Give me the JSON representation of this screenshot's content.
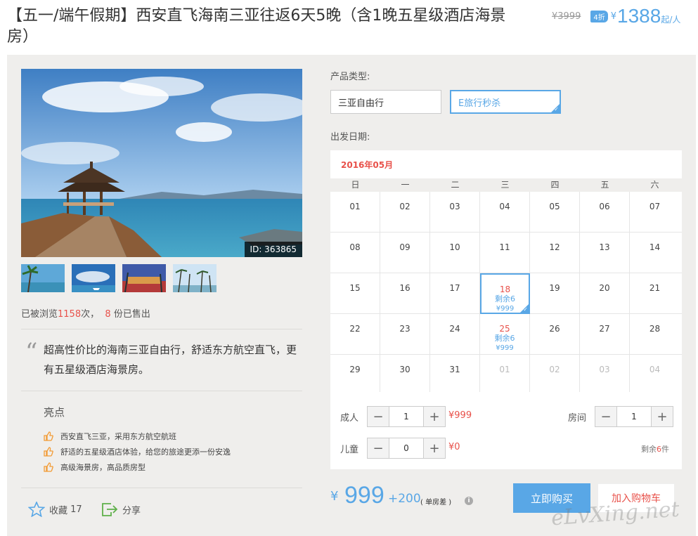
{
  "header": {
    "title": "【五一/端午假期】西安直飞海南三亚往返6天5晚（含1晚五星级酒店海景房）",
    "old_price": "¥3999",
    "discount": "4折",
    "currency": "¥",
    "price": "1388",
    "price_unit": "起/人"
  },
  "gallery": {
    "image_id": "ID: 363865",
    "thumbnails": [
      "beach-palms",
      "sky-boat",
      "resort-hotel",
      "palm-coast"
    ]
  },
  "stats": {
    "prefix": "已被浏览",
    "views": "1158",
    "mid": "次，",
    "sold": "8",
    "suffix": "份已售出"
  },
  "description": "超高性价比的海南三亚自由行，舒适东方航空直飞，更有五星级酒店海景房。",
  "highlights": {
    "title": "亮点",
    "items": [
      "西安直飞三亚，采用东方航空航班",
      "舒适的五星级酒店体验，给您的旅途更添一份安逸",
      "高级海景房，高品质房型"
    ]
  },
  "social": {
    "fav_label": "收藏",
    "fav_count": "17",
    "share_label": "分享"
  },
  "product": {
    "type_label": "产品类型:",
    "options": [
      "三亚自由行",
      "E旅行秒杀"
    ],
    "date_label": "出发日期:"
  },
  "calendar": {
    "month": "2016年05月",
    "weekdays": [
      "日",
      "一",
      "二",
      "三",
      "四",
      "五",
      "六"
    ],
    "weeks": [
      [
        {
          "d": "01"
        },
        {
          "d": "02"
        },
        {
          "d": "03"
        },
        {
          "d": "04"
        },
        {
          "d": "05"
        },
        {
          "d": "06"
        },
        {
          "d": "07"
        }
      ],
      [
        {
          "d": "08"
        },
        {
          "d": "09"
        },
        {
          "d": "10"
        },
        {
          "d": "11"
        },
        {
          "d": "12"
        },
        {
          "d": "13"
        },
        {
          "d": "14"
        }
      ],
      [
        {
          "d": "15"
        },
        {
          "d": "16"
        },
        {
          "d": "17"
        },
        {
          "d": "18",
          "rem": "剩余6",
          "price": "¥999",
          "selected": true
        },
        {
          "d": "19"
        },
        {
          "d": "20"
        },
        {
          "d": "21"
        }
      ],
      [
        {
          "d": "22"
        },
        {
          "d": "23"
        },
        {
          "d": "24"
        },
        {
          "d": "25",
          "rem": "剩余6",
          "price": "¥999"
        },
        {
          "d": "26"
        },
        {
          "d": "27"
        },
        {
          "d": "28"
        }
      ],
      [
        {
          "d": "29"
        },
        {
          "d": "30"
        },
        {
          "d": "31"
        },
        {
          "d": "01",
          "muted": true
        },
        {
          "d": "02",
          "muted": true
        },
        {
          "d": "03",
          "muted": true
        },
        {
          "d": "04",
          "muted": true
        }
      ]
    ]
  },
  "booking": {
    "adult_label": "成人",
    "adult_qty": "1",
    "adult_price": "¥999",
    "child_label": "儿童",
    "child_qty": "0",
    "child_price": "¥0",
    "room_label": "房间",
    "room_qty": "1",
    "stock_prefix": "剩余",
    "stock_count": "6",
    "stock_suffix": "件"
  },
  "purchase": {
    "currency": "¥",
    "price": "999",
    "extra": "+200",
    "extra_note": "( 单房差 )",
    "info_icon": "i",
    "buy_label": "立即购买",
    "cart_label": "加入购物车"
  },
  "watermark": "eLvXing.net",
  "colors": {
    "accent": "#59a7e6",
    "red": "#e8514a",
    "panel": "#efeeec"
  }
}
